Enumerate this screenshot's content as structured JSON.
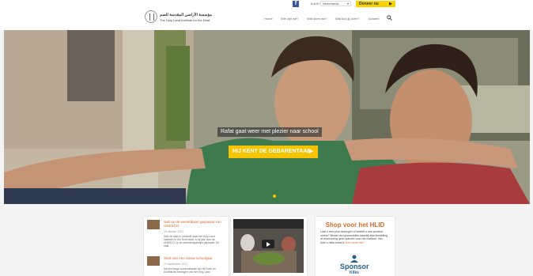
{
  "topbar": {
    "facebook_glyph": "f",
    "font_size_control": "A A A+",
    "language": "Nederlands",
    "donate_label": "Doneer nu",
    "donate_arrow": "▶"
  },
  "header": {
    "logo_arabic": "مؤسسة الأراضي المقدسة للصم",
    "logo_english": "The Holy Land Institute for the Deaf",
    "nav": [
      "Home",
      "Wie zijn we?",
      "Wat doen we?",
      "Wat kun jij doen?",
      "Actueel"
    ]
  },
  "hero": {
    "caption": "Rafat gaat weer met plezier naar school",
    "cta_label": "HIJ KENT DE GEBARENTAAL",
    "cta_arrow": "▶"
  },
  "news": [
    {
      "title": "Salt op de wereldkaart geplaatst van UNESCO",
      "date": "15 oktober 2021",
      "text": "Salt, de stad in Jordanië waar het Holy Land Institute for the Deaf staat, is dit jaar door de UNESCO op de werelderfgoedlijst geplaatst. De stad..."
    },
    {
      "title": "Start van een nieuw schooljaar",
      "date": "27 september 2021",
      "text": "Na een lange zomervakantie zijn de Dove en Doofblinde leerlingen van het Holy Land"
    }
  ],
  "shop": {
    "title": "Shop voor het HLID",
    "text": "Laat u een plus bezorgen of bestelt u een product online? Bestel via sponsorkliks waarbij elke bestelling of reservering geld oplevert voor het instituut. Het kost u niets extra's!",
    "link": "Hoe werkt het?",
    "sponsor_word": "Sponsor",
    "sponsor_sub": "Kliks"
  },
  "colors": {
    "accent": "#f6c400",
    "news_title": "#d26b2c",
    "facebook": "#3b5998"
  }
}
